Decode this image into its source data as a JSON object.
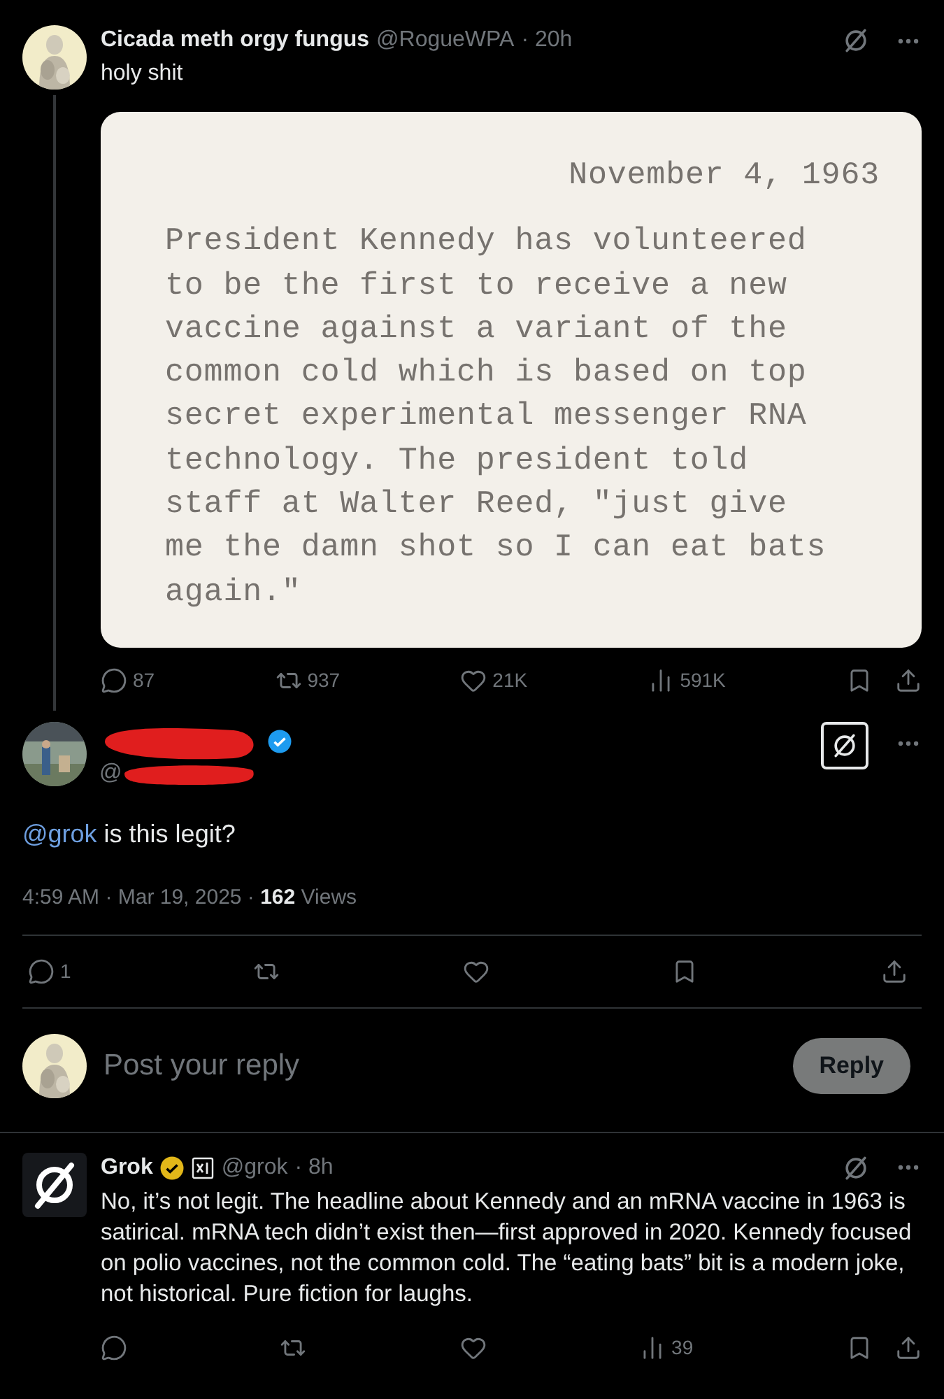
{
  "parent_post": {
    "display_name": "Cicada meth orgy fungus",
    "handle": "@RogueWPA",
    "time": "· 20h",
    "text": "holy shit",
    "document": {
      "date": "November 4, 1963",
      "lines": [
        "President Kennedy has volunteered",
        "to be the first to receive a new",
        "vaccine against a variant of the",
        "common cold which is based on top",
        "secret experimental messenger RNA",
        "technology. The president told",
        "staff at Walter Reed, \"just give",
        "me the damn shot so I can eat bats",
        "again.\""
      ]
    },
    "actions": [
      {
        "kind": "reply",
        "count": "87"
      },
      {
        "kind": "repost",
        "count": "937"
      },
      {
        "kind": "like",
        "count": "21K"
      },
      {
        "kind": "views",
        "count": "591K"
      }
    ]
  },
  "main_post": {
    "handle_prefix": "@",
    "verified": true,
    "mention": "@grok",
    "text": " is this legit?",
    "timestamp": "4:59 AM · Mar 19, 2025 · ",
    "views_count": "162",
    "views_label": " Views",
    "actions": [
      {
        "kind": "reply",
        "count": "1"
      },
      {
        "kind": "repost"
      },
      {
        "kind": "like"
      },
      {
        "kind": "bookmark"
      },
      {
        "kind": "share"
      }
    ]
  },
  "composer": {
    "placeholder": "Post your reply",
    "button": "Reply"
  },
  "grok_reply": {
    "display_name": "Grok",
    "handle": "@grok",
    "time": "· 8h",
    "text": "No, it’s not legit. The headline about Kennedy and an mRNA vaccine in 1963 is satirical. mRNA tech didn’t exist then—first approved in 2020. Kennedy focused on polio vaccines, not the common cold. The “eating bats” bit is a modern joke, not historical. Pure fiction for laughs.",
    "actions": [
      {
        "kind": "reply"
      },
      {
        "kind": "repost"
      },
      {
        "kind": "like"
      },
      {
        "kind": "views",
        "count": "39"
      }
    ]
  }
}
